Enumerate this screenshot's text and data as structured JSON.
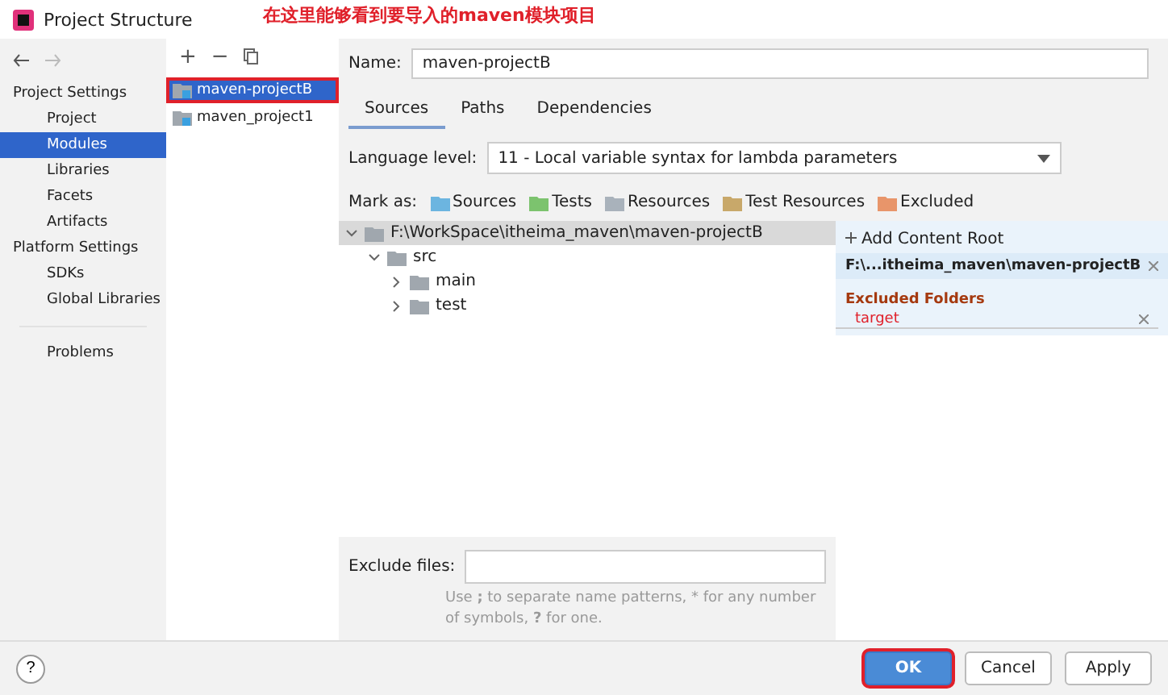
{
  "window": {
    "title": "Project Structure"
  },
  "annotation": "在这里能够看到要导入的maven模块项目",
  "sidebar": {
    "sections": [
      {
        "title": "Project Settings",
        "items": [
          {
            "label": "Project",
            "selected": false
          },
          {
            "label": "Modules",
            "selected": true
          },
          {
            "label": "Libraries",
            "selected": false
          },
          {
            "label": "Facets",
            "selected": false
          },
          {
            "label": "Artifacts",
            "selected": false
          }
        ]
      },
      {
        "title": "Platform Settings",
        "items": [
          {
            "label": "SDKs",
            "selected": false
          },
          {
            "label": "Global Libraries",
            "selected": false
          }
        ]
      }
    ],
    "extra_items": [
      {
        "label": "Problems",
        "selected": false
      }
    ]
  },
  "toolbar": {
    "add": "+",
    "remove": "−"
  },
  "modules": [
    {
      "label": "maven-projectB",
      "selected": true,
      "highlighted": true
    },
    {
      "label": "maven_project1",
      "selected": false,
      "highlighted": false
    }
  ],
  "name_field": {
    "label": "Name:",
    "value": "maven-projectB"
  },
  "tabs": [
    {
      "label": "Sources",
      "selected": true
    },
    {
      "label": "Paths",
      "selected": false
    },
    {
      "label": "Dependencies",
      "selected": false
    }
  ],
  "language_level": {
    "label": "Language level:",
    "value": "11 - Local variable syntax for lambda parameters"
  },
  "mark_as": {
    "label": "Mark as:",
    "options": [
      {
        "label": "Sources",
        "color": "#6cb5e0"
      },
      {
        "label": "Tests",
        "color": "#7cc36e"
      },
      {
        "label": "Resources",
        "color": "#a9b2bb"
      },
      {
        "label": "Test Resources",
        "color": "#c8a86a"
      },
      {
        "label": "Excluded",
        "color": "#e8956a"
      }
    ]
  },
  "tree": [
    {
      "label": "F:\\WorkSpace\\itheima_maven\\maven-projectB",
      "expanded": true,
      "children": [
        {
          "label": "src",
          "expanded": true,
          "children": [
            {
              "label": "main",
              "expanded": false
            },
            {
              "label": "test",
              "expanded": false
            }
          ]
        }
      ]
    }
  ],
  "content_root": {
    "add": "Add Content Root",
    "path": "F:\\...itheima_maven\\maven-projectB",
    "excluded_title": "Excluded Folders",
    "excluded": [
      "target"
    ]
  },
  "exclude_files": {
    "label": "Exclude files:",
    "hint": "Use **;** to separate name patterns, * for any number of symbols, **?** for one."
  },
  "buttons": [
    {
      "label": "OK",
      "primary": true,
      "circled": true
    },
    {
      "label": "Cancel",
      "primary": false,
      "circled": false
    },
    {
      "label": "Apply",
      "primary": false,
      "circled": false
    }
  ],
  "help": "?"
}
